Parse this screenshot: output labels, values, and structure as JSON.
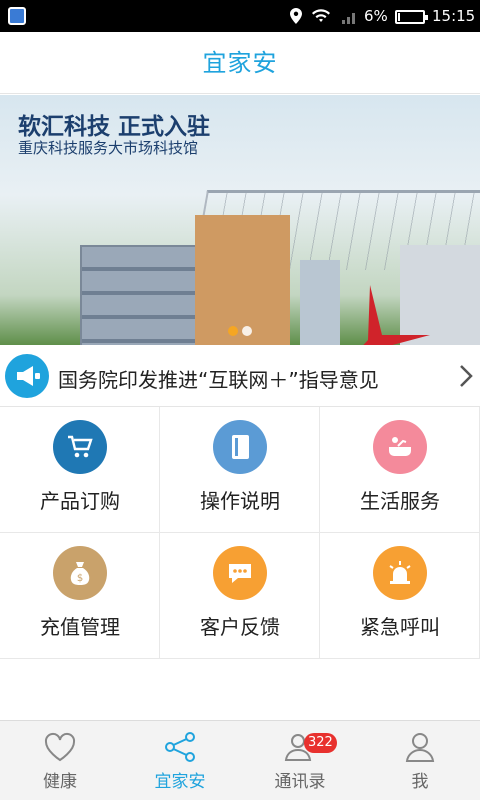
{
  "status_bar": {
    "battery_percent": "6%",
    "battery_level": 0.06,
    "time": "15:15"
  },
  "header": {
    "title": "宜家安"
  },
  "banner": {
    "headline": "软汇科技 正式入驻",
    "subline": "重庆科技服务大市场科技馆",
    "slide_count": 2,
    "active_slide": 1
  },
  "notice": {
    "text": "国务院印发推进“互联网＋”指导意见"
  },
  "services": [
    {
      "label": "产品订购",
      "icon": "cart-icon",
      "color": "#1f78b4"
    },
    {
      "label": "操作说明",
      "icon": "book-icon",
      "color": "#5b9bd5"
    },
    {
      "label": "生活服务",
      "icon": "bathtub-icon",
      "color": "#f48a9b"
    },
    {
      "label": "充值管理",
      "icon": "money-bag-icon",
      "color": "#c9a26b"
    },
    {
      "label": "客户反馈",
      "icon": "chat-bubble-icon",
      "color": "#f7a033"
    },
    {
      "label": "紧急呼叫",
      "icon": "alarm-light-icon",
      "color": "#f7a033"
    }
  ],
  "bottom_nav": {
    "items": [
      {
        "label": "健康",
        "icon": "heart-icon"
      },
      {
        "label": "宜家安",
        "icon": "share-icon",
        "active": true
      },
      {
        "label": "通讯录",
        "icon": "contacts-icon",
        "badge": "322"
      },
      {
        "label": "我",
        "icon": "user-icon"
      }
    ]
  },
  "colors": {
    "accent": "#1fa3dd",
    "badge": "#e8312e"
  }
}
